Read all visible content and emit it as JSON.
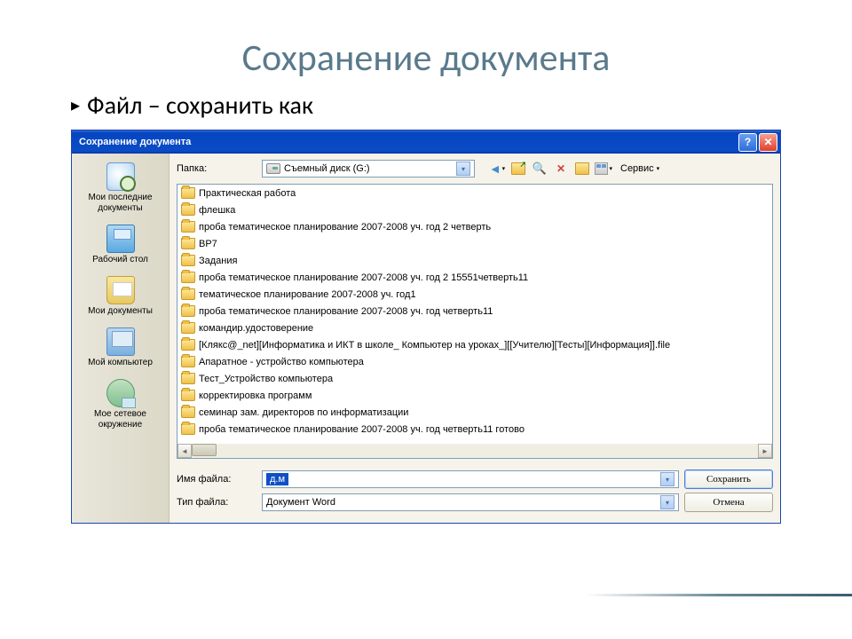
{
  "slide": {
    "title": "Сохранение документа",
    "bullet": "Файл – сохранить как"
  },
  "dialog": {
    "title": "Сохранение документа",
    "folderLabel": "Папка:",
    "folderValue": "Съемный диск (G:)",
    "toolsLabel": "Сервис",
    "filenameLabel": "Имя файла:",
    "filenameValue": "д.м",
    "filetypeLabel": "Тип файла:",
    "filetypeValue": "Документ Word",
    "saveBtn": "Сохранить",
    "cancelBtn": "Отмена"
  },
  "sidebar": [
    {
      "label": "Мои последние документы",
      "icon": "ico-recent"
    },
    {
      "label": "Рабочий стол",
      "icon": "ico-desktop"
    },
    {
      "label": "Мои документы",
      "icon": "ico-mydocs"
    },
    {
      "label": "Мой компьютер",
      "icon": "ico-mycomp"
    },
    {
      "label": "Мое сетевое окружение",
      "icon": "ico-network"
    }
  ],
  "files": [
    "Практическая работа",
    "флешка",
    "проба тематическое планирование 2007-2008 уч. год 2 четверть",
    "ВР7",
    "Задания",
    "проба тематическое планирование 2007-2008 уч. год 2 15551четверть11",
    "тематическое планирование 2007-2008 уч. год1",
    "проба тематическое планирование 2007-2008 уч. год четверть11",
    "командир.удостоверение",
    "[Клякс@_net][Информатика и ИКТ в школе_ Компьютер на уроках_][[Учителю][Тесты][Информация]].file",
    "Апаратное - устройство компьютера",
    "Тест_Устройство компьютера",
    "корректировка программ",
    "семинар зам. директоров по информатизации",
    "проба тематическое планирование 2007-2008 уч. год четверть11 готово"
  ]
}
